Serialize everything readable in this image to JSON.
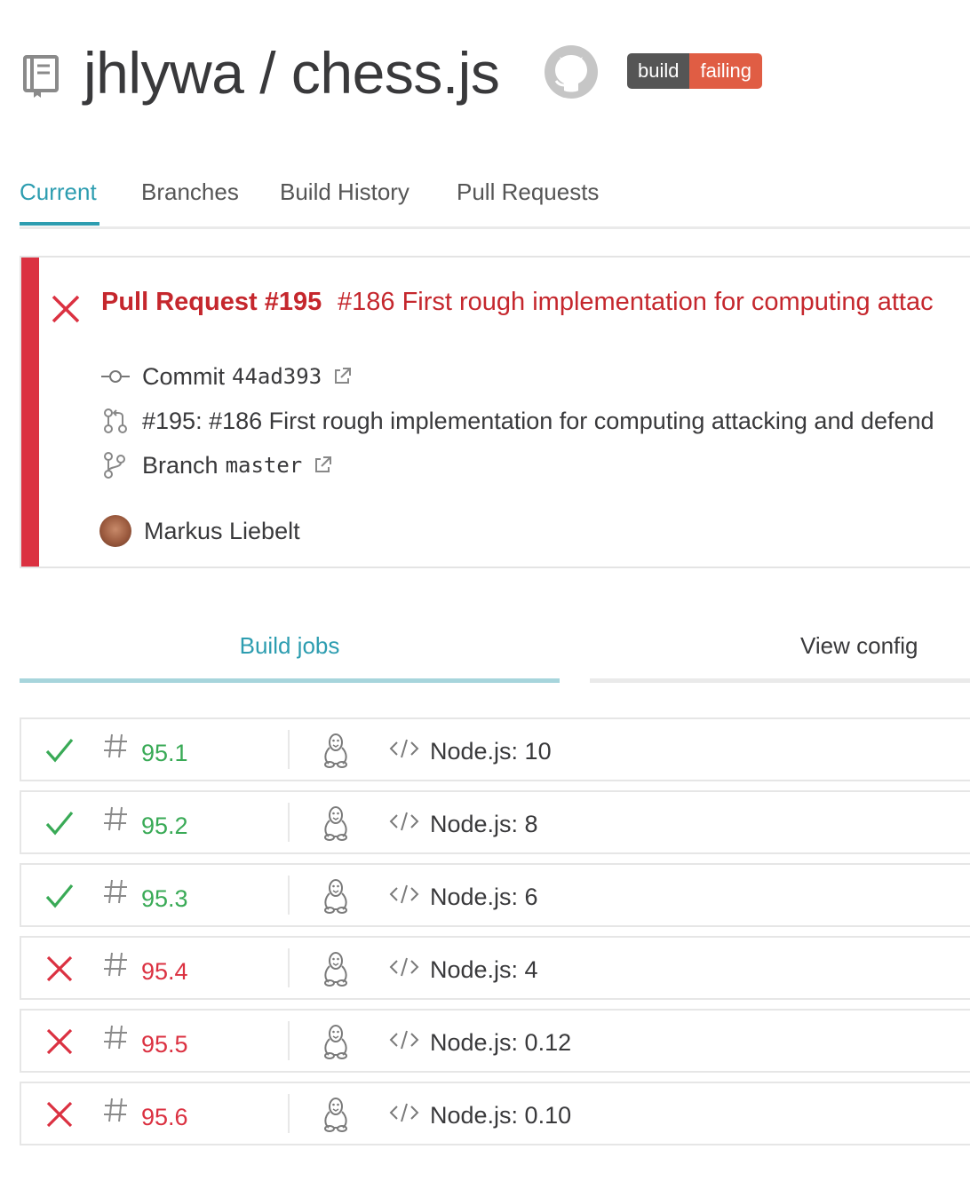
{
  "repo": {
    "title": "jhlywa / chess.js"
  },
  "badge": {
    "left": "build",
    "right": "failing"
  },
  "tabs": [
    {
      "label": "Current"
    },
    {
      "label": "Branches"
    },
    {
      "label": "Build History"
    },
    {
      "label": "Pull Requests"
    }
  ],
  "build": {
    "title": "Pull Request #195",
    "message": "#186 First rough implementation for computing attac",
    "commit_label": "Commit",
    "commit_sha": "44ad393",
    "pr_line": "#195: #186 First rough implementation for computing attacking and defend",
    "branch_label": "Branch",
    "branch_name": "master",
    "author": "Markus Liebelt",
    "state": "failed"
  },
  "job_tabs": {
    "build_jobs": "Build jobs",
    "view_config": "View config"
  },
  "jobs": [
    {
      "number": "95.1",
      "env": "Node.js: 10",
      "state": "passed"
    },
    {
      "number": "95.2",
      "env": "Node.js: 8",
      "state": "passed"
    },
    {
      "number": "95.3",
      "env": "Node.js: 6",
      "state": "passed"
    },
    {
      "number": "95.4",
      "env": "Node.js: 4",
      "state": "failed"
    },
    {
      "number": "95.5",
      "env": "Node.js: 0.12",
      "state": "failed"
    },
    {
      "number": "95.6",
      "env": "Node.js: 0.10",
      "state": "failed"
    }
  ],
  "colors": {
    "accent": "#2d9db0",
    "failed": "#db3141",
    "passed": "#39aa56"
  }
}
